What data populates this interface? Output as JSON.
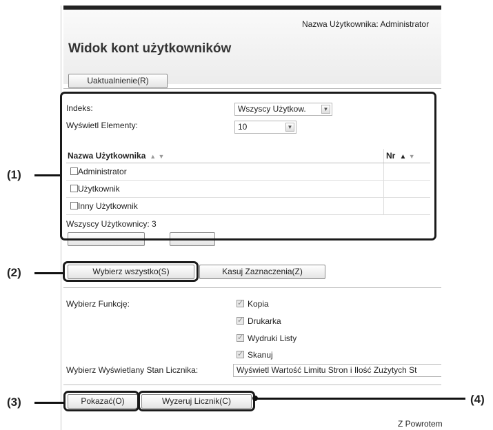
{
  "header": {
    "user_line": "Nazwa Użytkownika: Administrator",
    "title": "Widok kont użytkowników",
    "update_button": "Uaktualnienie(R)"
  },
  "filters": {
    "index_label": "Indeks:",
    "index_value": "Wszyscy Użytkow.",
    "display_label": "Wyświetl Elementy:",
    "display_value": "10"
  },
  "table": {
    "col_name": "Nazwa Użytkownika",
    "col_nr": "Nr",
    "rows": [
      {
        "name": "Administrator"
      },
      {
        "name": "Użytkownik"
      },
      {
        "name": "Inny Użytkownik"
      }
    ],
    "total": "Wszyscy Użytkownicy:  3"
  },
  "selection": {
    "select_all": "Wybierz wszystko(S)",
    "clear": "Kasuj Zaznaczenia(Z)"
  },
  "functions": {
    "label": "Wybierz Funkcję:",
    "items": [
      "Kopia",
      "Drukarka",
      "Wydruki Listy",
      "Skanuj"
    ],
    "counter_label": "Wybierz Wyświetlany Stan Licznika:",
    "counter_value": "Wyświetl Wartość Limitu Stron i Ilość Zużytych St"
  },
  "actions": {
    "show": "Pokazać(O)",
    "reset": "Wyzeruj Licznik(C)",
    "back": "Z Powrotem"
  },
  "callouts": [
    "(1)",
    "(2)",
    "(3)",
    "(4)"
  ]
}
